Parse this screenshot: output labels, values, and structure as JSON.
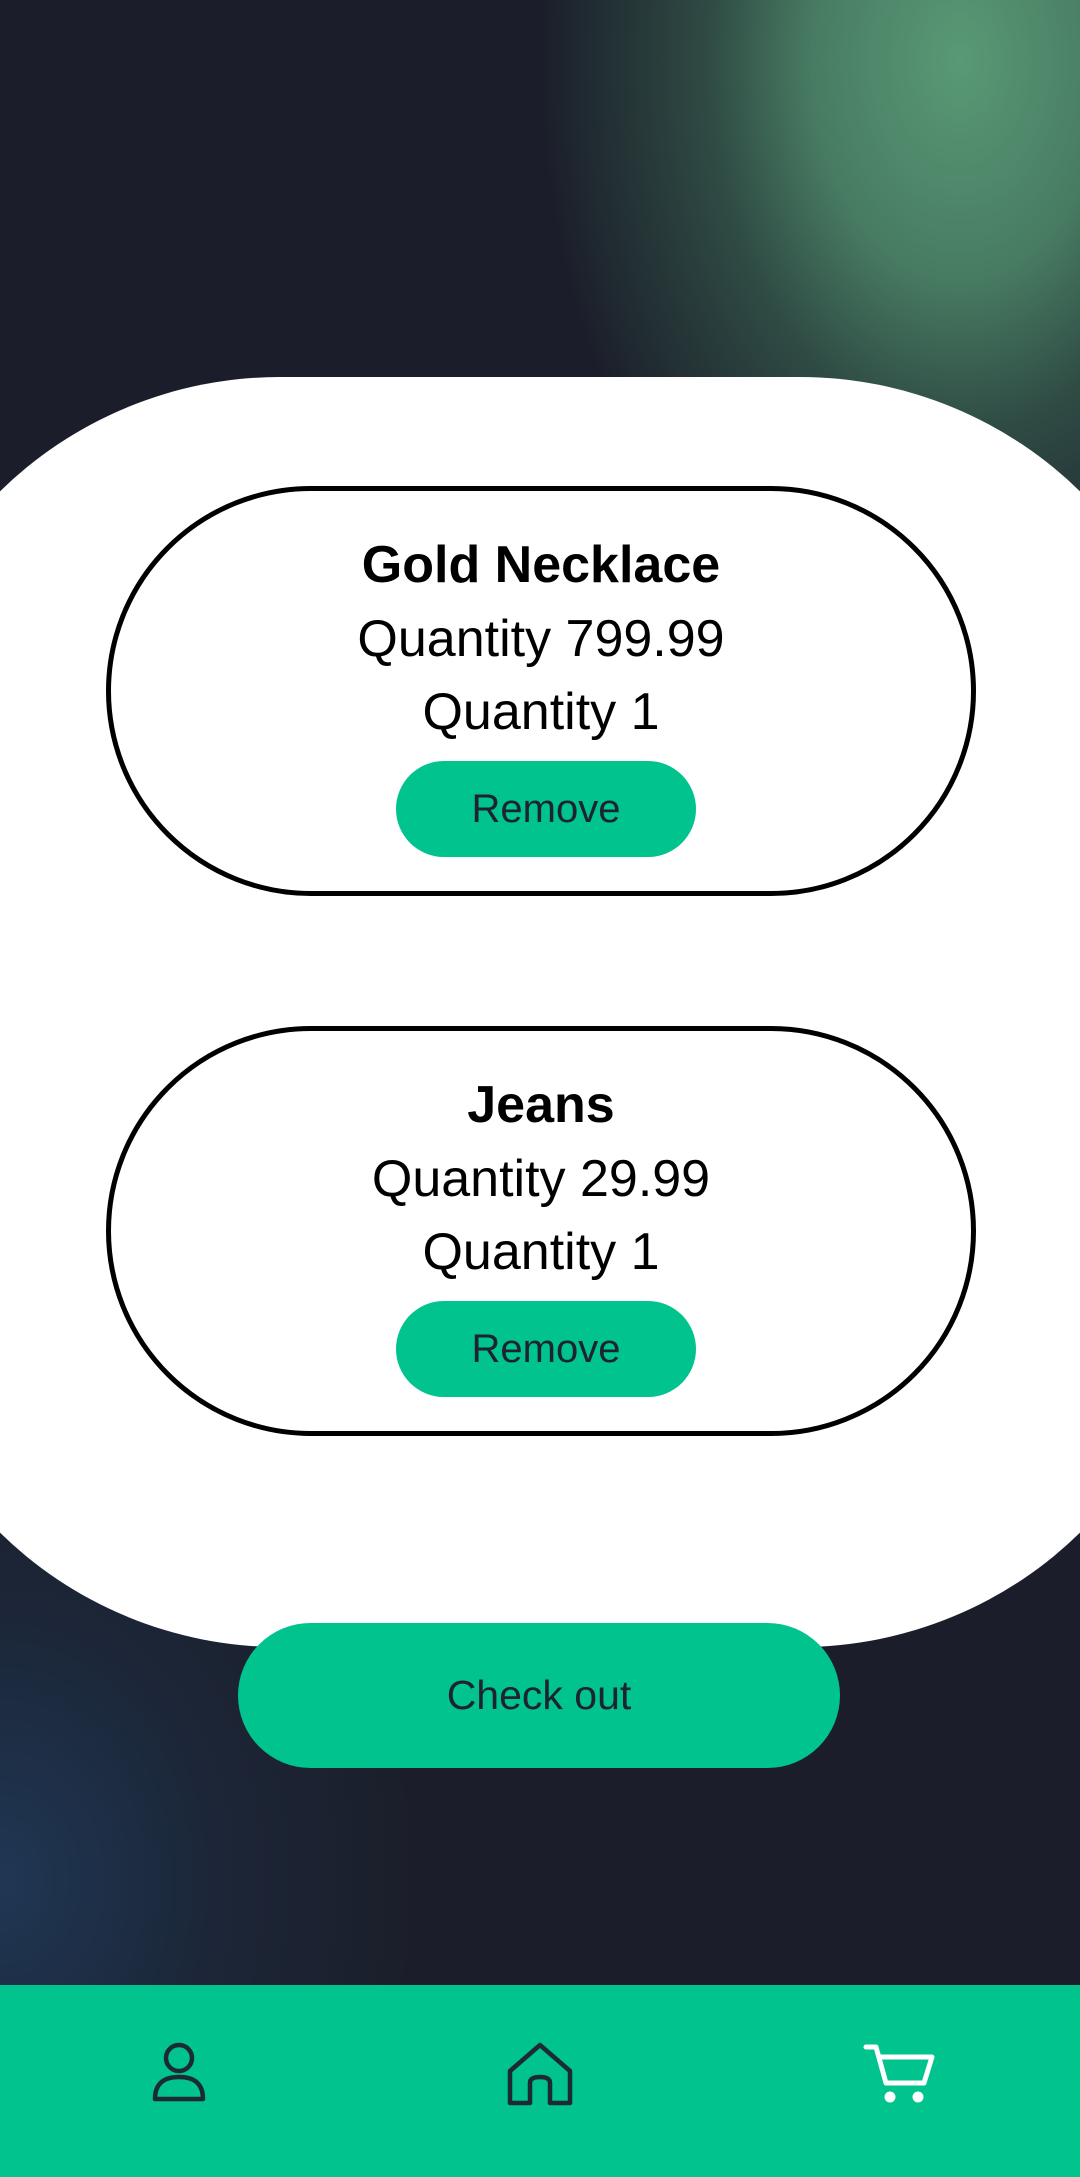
{
  "cart": {
    "items": [
      {
        "name": "Gold Necklace",
        "price_text": "Quantity 799.99",
        "quantity_text": "Quantity 1",
        "remove_label": "Remove"
      },
      {
        "name": "Jeans",
        "price_text": "Quantity 29.99",
        "quantity_text": "Quantity 1",
        "remove_label": "Remove"
      }
    ]
  },
  "checkout": {
    "label": "Check out"
  },
  "bottom_nav": {
    "items": [
      {
        "icon": "person-icon"
      },
      {
        "icon": "home-icon"
      },
      {
        "icon": "cart-icon",
        "active": true
      }
    ]
  },
  "colors": {
    "accent": "#00c38e",
    "background": "#1b1e2a",
    "card": "#ffffff",
    "nav_icon": "#1b2a33",
    "nav_icon_active": "#ffffff"
  }
}
